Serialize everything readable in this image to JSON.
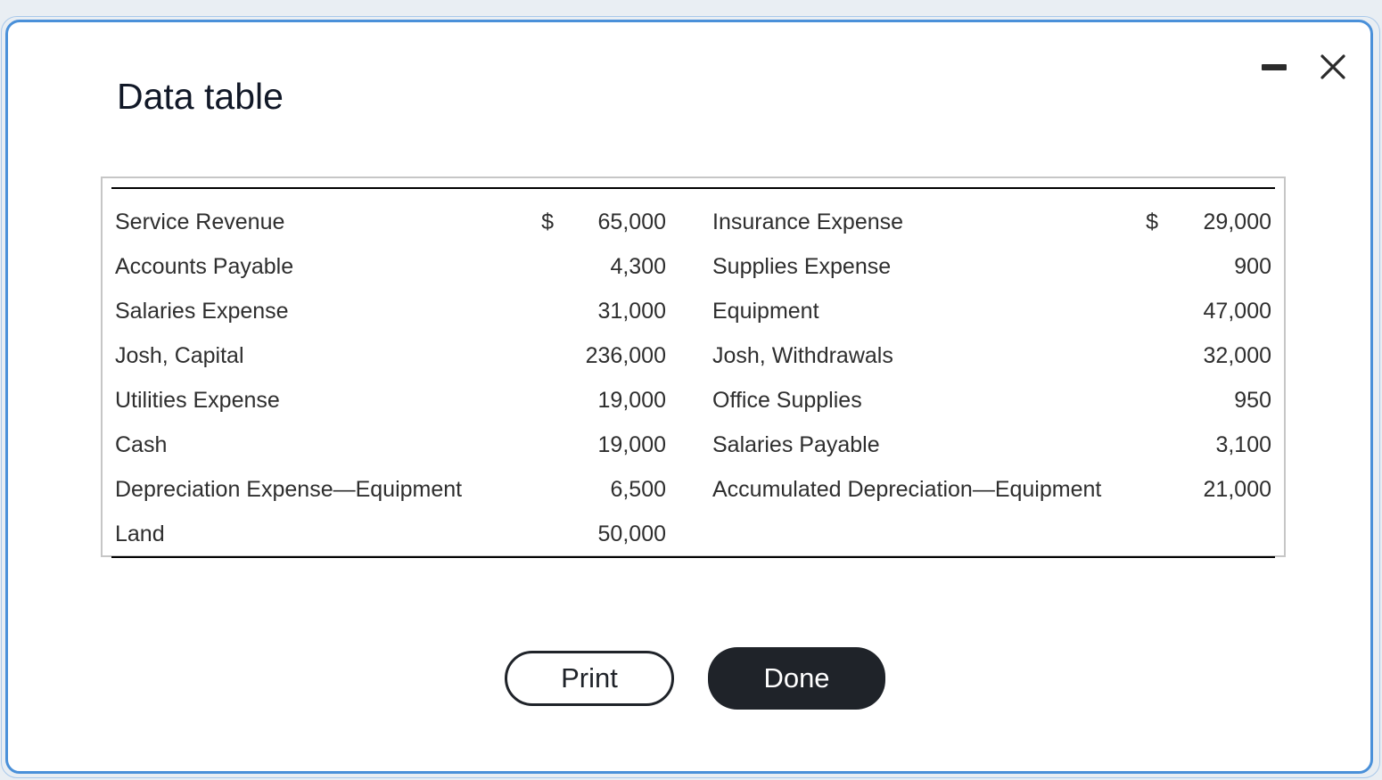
{
  "dialog": {
    "title": "Data table",
    "print_label": "Print",
    "done_label": "Done"
  },
  "table": {
    "rows": [
      {
        "left_label": "Service Revenue",
        "left_dollar": "$",
        "left_value": "65,000",
        "right_label": "Insurance Expense",
        "right_dollar": "$",
        "right_value": "29,000"
      },
      {
        "left_label": "Accounts Payable",
        "left_dollar": "",
        "left_value": "4,300",
        "right_label": "Supplies Expense",
        "right_dollar": "",
        "right_value": "900"
      },
      {
        "left_label": "Salaries Expense",
        "left_dollar": "",
        "left_value": "31,000",
        "right_label": "Equipment",
        "right_dollar": "",
        "right_value": "47,000"
      },
      {
        "left_label": "Josh, Capital",
        "left_dollar": "",
        "left_value": "236,000",
        "right_label": "Josh, Withdrawals",
        "right_dollar": "",
        "right_value": "32,000"
      },
      {
        "left_label": "Utilities Expense",
        "left_dollar": "",
        "left_value": "19,000",
        "right_label": "Office Supplies",
        "right_dollar": "",
        "right_value": "950"
      },
      {
        "left_label": "Cash",
        "left_dollar": "",
        "left_value": "19,000",
        "right_label": "Salaries Payable",
        "right_dollar": "",
        "right_value": "3,100"
      },
      {
        "left_label": "Depreciation Expense—Equipment",
        "left_dollar": "",
        "left_value": "6,500",
        "right_label": "Accumulated Depreciation—Equipment",
        "right_dollar": "",
        "right_value": "21,000"
      },
      {
        "left_label": "Land",
        "left_dollar": "",
        "left_value": "50,000",
        "right_label": "",
        "right_dollar": "",
        "right_value": ""
      }
    ]
  }
}
